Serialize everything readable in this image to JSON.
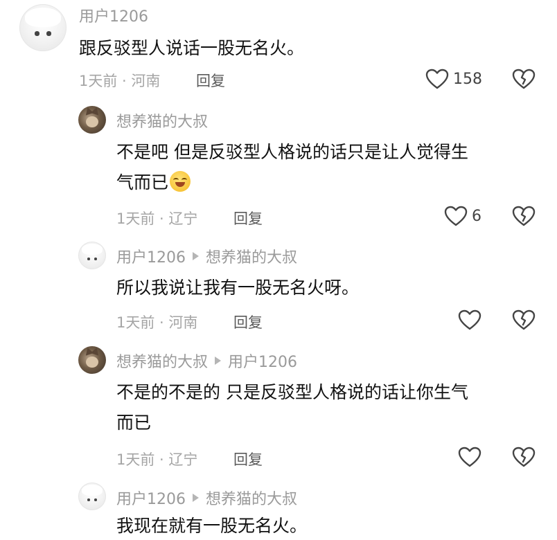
{
  "comments": [
    {
      "user": "用户1206",
      "reply_to": "",
      "text": "跟反驳型人说话一股无名火。",
      "time_location": "1天前 · 河南",
      "reply_label": "回复",
      "likes": "158"
    },
    {
      "user": "想养猫的大叔",
      "reply_to": "",
      "text_line1": "不是吧 但是反驳型人格说的话只是让人觉得生",
      "text_line2": "气而已",
      "emoji": "smile-emoji",
      "time_location": "1天前 · 辽宁",
      "reply_label": "回复",
      "likes": "6"
    },
    {
      "user": "用户1206",
      "reply_to": "想养猫的大叔",
      "text": "所以我说让我有一股无名火呀。",
      "time_location": "1天前 · 河南",
      "reply_label": "回复",
      "likes": ""
    },
    {
      "user": "想养猫的大叔",
      "reply_to": "用户1206",
      "text_line1": "不是的不是的 只是反驳型人格说的话让你生气",
      "text_line2": "而已",
      "time_location": "1天前 · 辽宁",
      "reply_label": "回复",
      "likes": ""
    },
    {
      "user": "用户1206",
      "reply_to": "想养猫的大叔",
      "text": "我现在就有一股无名火。"
    }
  ],
  "colors": {
    "username": "#9a9a9a",
    "meta": "#a5a5a5",
    "text": "#111111"
  },
  "icons": {
    "like": "heart-outline-icon",
    "dislike": "broken-heart-icon"
  }
}
